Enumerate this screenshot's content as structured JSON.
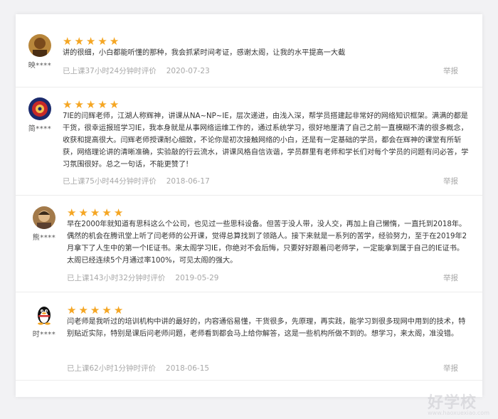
{
  "reviews": [
    {
      "user": "映****",
      "content": "讲的很细，小白都能听懂的那种，我会抓紧时间考证，感谢太阁，让我的水平提高一大截",
      "study_time": "已上课37小时24分钟时评价",
      "date": "2020-07-23",
      "report": "举报",
      "rating": 5
    },
    {
      "user": "简****",
      "content": "7IE的闫辉老师，江湖人称辉神，讲课从NA~NP~IE，层次递进，由浅入深，帮学员搭建起非常好的网络知识框架。满满的都是干货，很幸运报班学习IE，我本身就是从事网络运维工作的，通过系统学习，很好地厘清了自己之前一直模糊不清的很多概念，收获和提高很大。闫辉老师授课耐心细致，不论你是初次接触网络的小白，还是有一定基础的学员，都会在辉神的课堂有所斩获，网络理论讲的清晰准确，实验敲的行云流水，讲课风格自信诙谐，学员群里有老师和学长们对每个学员的问题有问必答，学习氛围很好。总之一句话，不能更赞了!",
      "study_time": "已上课75小时44分钟时评价",
      "date": "2018-06-17",
      "report": "举报",
      "rating": 5
    },
    {
      "user": "熊****",
      "content": "早在2000年就知道有思科这么个公司，也见过一些思科设备。但苦于没人带，没人交，再加上自己懒惰，一直托到2018年。偶然的机会在腾讯堂上听了闫老师的公开课，觉得总算找到了领路人。接下来就是一系列的苦学，经验努力，至于在2019年2月拿下了人生中的第一个IE证书。来太阁学习IE，你绝对不会后悔，只要好好跟着闫老师学，一定能拿到属于自己的IE证书。太阁已经连续5个月通过率100%，可见太阁的强大。",
      "study_time": "已上课143小时32分钟时评价",
      "date": "2019-05-29",
      "report": "举报",
      "rating": 5
    },
    {
      "user": "时****",
      "content": "闫老师是我听过的培训机构中讲的最好的，内容通俗易懂，干货很多，先原理，再实践，能学习到很多现网中用到的技术，特别贴近实际，特别是课后问老师问题，老师看到都会马上给你解答，这是一些机构所做不到的。想学习，来太阁，准没错。",
      "study_time": "已上课62小时1分钟时评价",
      "date": "2018-06-15",
      "report": "举报",
      "rating": 5
    }
  ],
  "star_glyph": "★",
  "star_color": "#f5a623",
  "watermark": {
    "brand": "好学校",
    "url": "www.haoxuexiao.com"
  }
}
